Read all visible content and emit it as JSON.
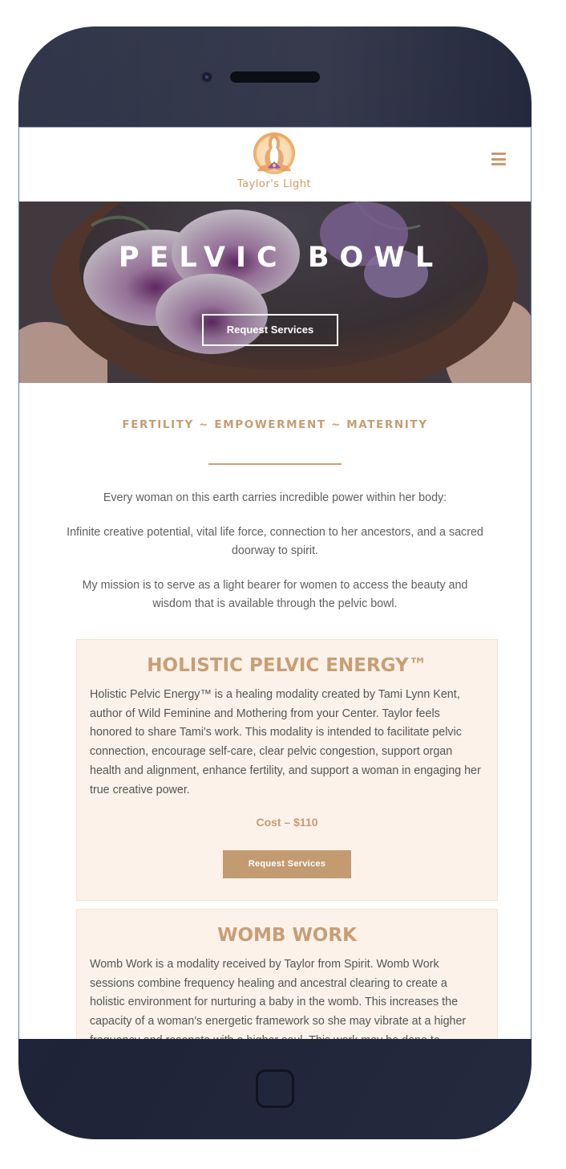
{
  "header": {
    "logo_text": "Taylor's Light",
    "menu_icon": "hamburger-menu-icon"
  },
  "hero": {
    "title": "PELVIC BOWL",
    "button_label": "Request Services"
  },
  "intro": {
    "tagline": "FERTILITY ~ EMPOWERMENT ~ MATERNITY",
    "paragraphs": [
      "Every woman on this earth carries incredible power within her body:",
      "Infinite creative potential, vital life force, connection to her ancestors, and a sacred doorway to spirit.",
      "My mission is to serve as a light bearer for women to access the beauty and wisdom that is available through the pelvic bowl."
    ]
  },
  "services": [
    {
      "title": "HOLISTIC PELVIC ENERGY™",
      "description": "Holistic Pelvic Energy™ is a healing modality created by Tami Lynn Kent, author of Wild Feminine and Mothering from your Center. Taylor feels honored to share Tami's work. This modality is intended to facilitate pelvic connection, encourage self-care, clear pelvic congestion, support organ health and alignment, enhance fertility, and support a woman in engaging her true creative power.",
      "cost": "Cost – $110",
      "button_label": "Request Services"
    },
    {
      "title": "WOMB WORK",
      "description": "Womb Work is a modality received by Taylor from Spirit. Womb Work sessions combine frequency healing and ancestral clearing to create a holistic environment for nurturing a baby in the womb. This increases the capacity of a woman's energetic framework so she may vibrate at a higher frequency and resonate with a higher soul. This work may be done to"
    }
  ],
  "colors": {
    "accent": "#c59c72",
    "card_background": "#fcf2ea",
    "phone_body": "#23273a"
  }
}
